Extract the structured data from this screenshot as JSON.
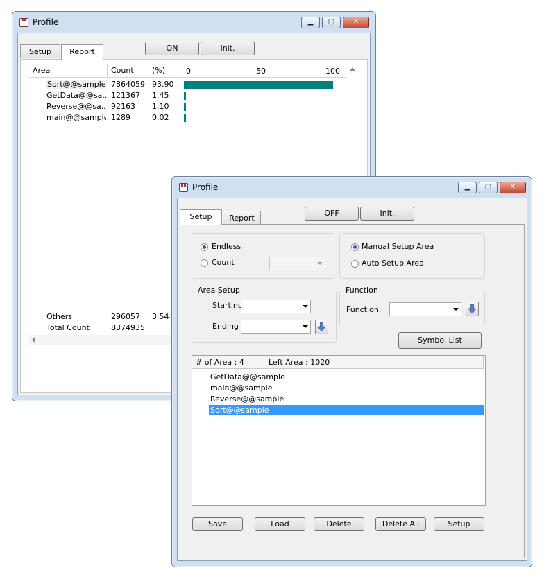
{
  "back_window": {
    "title": "Profile",
    "tabs": [
      {
        "label": "Setup"
      },
      {
        "label": "Report"
      }
    ],
    "buttons": {
      "on": "ON",
      "init": "Init."
    },
    "columns": {
      "area": "Area",
      "count": "Count",
      "percent": "(%)",
      "scale_0": "0",
      "scale_50": "50",
      "scale_100": "100"
    },
    "rows": [
      {
        "area": "Sort@@sample",
        "count": "7864059",
        "percent": "93.90",
        "value": 93.9
      },
      {
        "area": "GetData@@sa...",
        "count": "121367",
        "percent": "1.45",
        "value": 1.45
      },
      {
        "area": "Reverse@@sa...",
        "count": "92163",
        "percent": "1.10",
        "value": 1.1
      },
      {
        "area": "main@@sample",
        "count": "1289",
        "percent": "0.02",
        "value": 0.02
      }
    ],
    "others": {
      "label": "Others",
      "count": "296057",
      "percent": "3.54"
    },
    "total": {
      "label": "Total Count",
      "count": "8374935"
    },
    "bar_color": "#007f7f"
  },
  "front_window": {
    "title": "Profile",
    "tabs": [
      {
        "label": "Setup"
      },
      {
        "label": "Report"
      }
    ],
    "buttons": {
      "off": "OFF",
      "init": "Init."
    },
    "mode": {
      "endless_label": "Endless",
      "count_label": "Count",
      "selected": "Endless",
      "count_value": ""
    },
    "setup_area": {
      "manual_label": "Manual Setup Area",
      "auto_label": "Auto Setup Area",
      "selected": "Manual Setup Area"
    },
    "area_setup": {
      "title": "Area Setup",
      "starting_label": "Starting",
      "starting_value": "",
      "ending_label": "Ending",
      "ending_value": ""
    },
    "function": {
      "title": "Function",
      "label": "Function:",
      "value": ""
    },
    "symbol_list_label": "Symbol List",
    "area_list": {
      "num_of_area": "# of Area : 4",
      "left_area": "Left Area : 1020",
      "items": [
        {
          "label": "GetData@@sample"
        },
        {
          "label": "main@@sample"
        },
        {
          "label": "Reverse@@sample"
        },
        {
          "label": "Sort@@sample"
        }
      ],
      "selected_index": 3,
      "selection_color": "#3399ff"
    },
    "bottom_buttons": {
      "save": "Save",
      "load": "Load",
      "delete": "Delete",
      "delete_all": "Delete All",
      "setup": "Setup"
    }
  }
}
